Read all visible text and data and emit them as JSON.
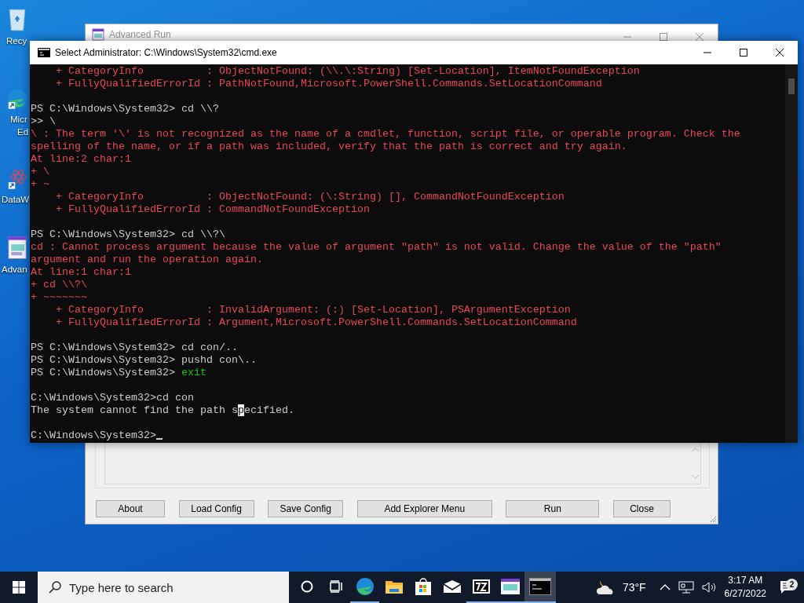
{
  "desktop_icons": [
    {
      "kind": "bin",
      "label": [
        "Recy"
      ]
    },
    {
      "kind": "edge",
      "label": [
        "Micr",
        "Ed"
      ]
    },
    {
      "kind": "atom",
      "label": [
        "DataW"
      ]
    },
    {
      "kind": "app",
      "label": [
        "Advan"
      ]
    }
  ],
  "background_window": {
    "title": "Advanced Run",
    "buttons": [
      "About",
      "Load Config",
      "Save Config",
      "Add Explorer Menu",
      "Run",
      "Close"
    ]
  },
  "terminal": {
    "title": "Select Administrator: C:\\Windows\\System32\\cmd.exe",
    "cursor": true,
    "lines": [
      {
        "kind": "text",
        "segments": [
          {
            "kind": "error",
            "text": "    + CategoryInfo          : ObjectNotFound: (\\\\.\\:String) [Set-Location], ItemNotFoundException"
          }
        ]
      },
      {
        "kind": "text",
        "segments": [
          {
            "kind": "error",
            "text": "    + FullyQualifiedErrorId : PathNotFound,Microsoft.PowerShell.Commands.SetLocationCommand"
          }
        ]
      },
      {
        "kind": "blank"
      },
      {
        "kind": "text",
        "segments": [
          {
            "kind": "plain",
            "text": "PS C:\\Windows\\System32> cd \\\\?"
          }
        ]
      },
      {
        "kind": "text",
        "segments": [
          {
            "kind": "plain",
            "text": ">> \\"
          }
        ]
      },
      {
        "kind": "text",
        "segments": [
          {
            "kind": "error",
            "text": "\\ : The term '\\' is not recognized as the name of a cmdlet, function, script file, or operable program. Check the"
          }
        ]
      },
      {
        "kind": "text",
        "segments": [
          {
            "kind": "error",
            "text": "spelling of the name, or if a path was included, verify that the path is correct and try again."
          }
        ]
      },
      {
        "kind": "text",
        "segments": [
          {
            "kind": "error",
            "text": "At line:2 char:1"
          }
        ]
      },
      {
        "kind": "text",
        "segments": [
          {
            "kind": "error",
            "text": "+ \\"
          }
        ]
      },
      {
        "kind": "text",
        "segments": [
          {
            "kind": "error",
            "text": "+ ~"
          }
        ]
      },
      {
        "kind": "text",
        "segments": [
          {
            "kind": "error",
            "text": "    + CategoryInfo          : ObjectNotFound: (\\:String) [], CommandNotFoundException"
          }
        ]
      },
      {
        "kind": "text",
        "segments": [
          {
            "kind": "error",
            "text": "    + FullyQualifiedErrorId : CommandNotFoundException"
          }
        ]
      },
      {
        "kind": "blank"
      },
      {
        "kind": "text",
        "segments": [
          {
            "kind": "plain",
            "text": "PS C:\\Windows\\System32> cd \\\\?\\"
          }
        ]
      },
      {
        "kind": "text",
        "segments": [
          {
            "kind": "error",
            "text": "cd : Cannot process argument because the value of argument \"path\" is not valid. Change the value of the \"path\""
          }
        ]
      },
      {
        "kind": "text",
        "segments": [
          {
            "kind": "error",
            "text": "argument and run the operation again."
          }
        ]
      },
      {
        "kind": "text",
        "segments": [
          {
            "kind": "error",
            "text": "At line:1 char:1"
          }
        ]
      },
      {
        "kind": "text",
        "segments": [
          {
            "kind": "error",
            "text": "+ cd \\\\?\\"
          }
        ]
      },
      {
        "kind": "text",
        "segments": [
          {
            "kind": "error",
            "text": "+ ~~~~~~~"
          }
        ]
      },
      {
        "kind": "text",
        "segments": [
          {
            "kind": "error",
            "text": "    + CategoryInfo          : InvalidArgument: (:) [Set-Location], PSArgumentException"
          }
        ]
      },
      {
        "kind": "text",
        "segments": [
          {
            "kind": "error",
            "text": "    + FullyQualifiedErrorId : Argument,Microsoft.PowerShell.Commands.SetLocationCommand"
          }
        ]
      },
      {
        "kind": "blank"
      },
      {
        "kind": "text",
        "segments": [
          {
            "kind": "plain",
            "text": "PS C:\\Windows\\System32> cd con/.."
          }
        ]
      },
      {
        "kind": "text",
        "segments": [
          {
            "kind": "plain",
            "text": "PS C:\\Windows\\System32> pushd con\\.."
          }
        ]
      },
      {
        "kind": "text",
        "segments": [
          {
            "kind": "plain",
            "text": "PS C:\\Windows\\System32> "
          },
          {
            "kind": "keyword",
            "text": "exit"
          }
        ]
      },
      {
        "kind": "blank"
      },
      {
        "kind": "text",
        "segments": [
          {
            "kind": "plain",
            "text": "C:\\Windows\\System32>cd con"
          }
        ]
      },
      {
        "kind": "text",
        "segments": [
          {
            "kind": "plain",
            "text": "The system cannot find the path s"
          },
          {
            "kind": "selected",
            "text": "p"
          },
          {
            "kind": "plain",
            "text": "ecified."
          }
        ]
      },
      {
        "kind": "blank"
      },
      {
        "kind": "text",
        "segments": [
          {
            "kind": "plain",
            "text": "C:\\Windows\\System32>"
          }
        ]
      }
    ]
  },
  "taskbar": {
    "search": {
      "placeholder": "Type here to search"
    },
    "items": [
      {
        "kind": "cortana",
        "running": false,
        "selected": false
      },
      {
        "kind": "taskview",
        "running": false,
        "selected": false
      },
      {
        "kind": "edge",
        "running": true,
        "selected": false
      },
      {
        "kind": "folder",
        "running": false,
        "selected": false
      },
      {
        "kind": "store",
        "running": false,
        "selected": false
      },
      {
        "kind": "mail",
        "running": false,
        "selected": false
      },
      {
        "kind": "zip",
        "running": true,
        "selected": false
      },
      {
        "kind": "app",
        "running": true,
        "selected": false
      },
      {
        "kind": "console",
        "running": true,
        "selected": true
      }
    ],
    "weather": "73°F",
    "time": "3:17 AM",
    "date": "6/27/2022",
    "notifications": "2"
  }
}
